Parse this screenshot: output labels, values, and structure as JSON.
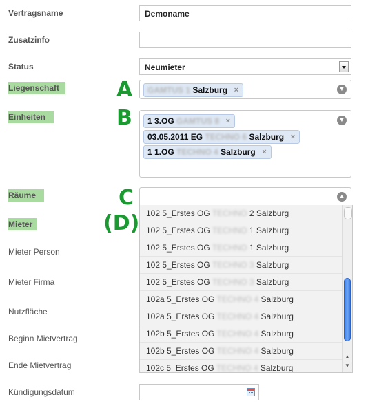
{
  "labels": {
    "vertragsname": "Vertragsname",
    "zusatzinfo": "Zusatzinfo",
    "status": "Status",
    "liegenschaft": "Liegenschaft",
    "einheiten": "Einheiten",
    "raeume": "Räume",
    "mieter": "Mieter",
    "mieter_person": "Mieter Person",
    "mieter_firma": "Mieter Firma",
    "nutzflaeche": "Nutzfläche",
    "beginn_mietvertrag": "Beginn Mietvertrag",
    "ende_mietvertrag": "Ende Mietvertrag",
    "kuendigungsdatum": "Kündigungsdatum"
  },
  "fields": {
    "vertragsname_value": "Demoname",
    "zusatzinfo_value": "",
    "status_value": "Neumieter"
  },
  "liegenschaft_tag": {
    "blurred": "GAMTUS 1",
    "text": "Salzburg"
  },
  "einheiten_tags": [
    {
      "prefix": "1 3.OG",
      "blurred": "GAMTUS 8",
      "suffix": ""
    },
    {
      "prefix": "03.05.2011 EG",
      "blurred": "TECHNO 6",
      "suffix": "Salzburg"
    },
    {
      "prefix": "1 1.OG",
      "blurred": "TECHNO 4",
      "suffix": "Salzburg"
    }
  ],
  "markers": {
    "a": "A",
    "b": "B",
    "c": "C",
    "d": "(D)"
  },
  "dropdown_options": [
    {
      "prefix": "102 5_Erstes OG",
      "blurred": "TECHNO",
      "suffix": "2 Salzburg"
    },
    {
      "prefix": "102 5_Erstes OG",
      "blurred": "TECHNO",
      "suffix": "1 Salzburg"
    },
    {
      "prefix": "102 5_Erstes OG",
      "blurred": "TECHNO",
      "suffix": "1 Salzburg"
    },
    {
      "prefix": "102 5_Erstes OG",
      "blurred": "TECHNO 3",
      "suffix": "Salzburg"
    },
    {
      "prefix": "102 5_Erstes OG",
      "blurred": "TECHNO 3",
      "suffix": "Salzburg"
    },
    {
      "prefix": "102a 5_Erstes OG",
      "blurred": "TECHNO 4",
      "suffix": "Salzburg"
    },
    {
      "prefix": "102a 5_Erstes OG",
      "blurred": "TECHNO 4",
      "suffix": "Salzburg"
    },
    {
      "prefix": "102b 5_Erstes OG",
      "blurred": "TECHNO 4",
      "suffix": "Salzburg"
    },
    {
      "prefix": "102b 5_Erstes OG",
      "blurred": "TECHNO 4",
      "suffix": "Salzburg"
    },
    {
      "prefix": "102c 5_Erstes OG",
      "blurred": "TECHNO 4",
      "suffix": "Salzburg"
    }
  ],
  "icons": {
    "chevron_down": "chevron-down-icon",
    "chevron_up": "chevron-up-icon",
    "remove": "×",
    "calendar": "calendar-icon"
  },
  "colors": {
    "label_highlight": "#a9dba0",
    "marker": "#1c9a32",
    "tag_bg": "#dfe9f6",
    "scroll_thumb": "#3d7ee6"
  }
}
